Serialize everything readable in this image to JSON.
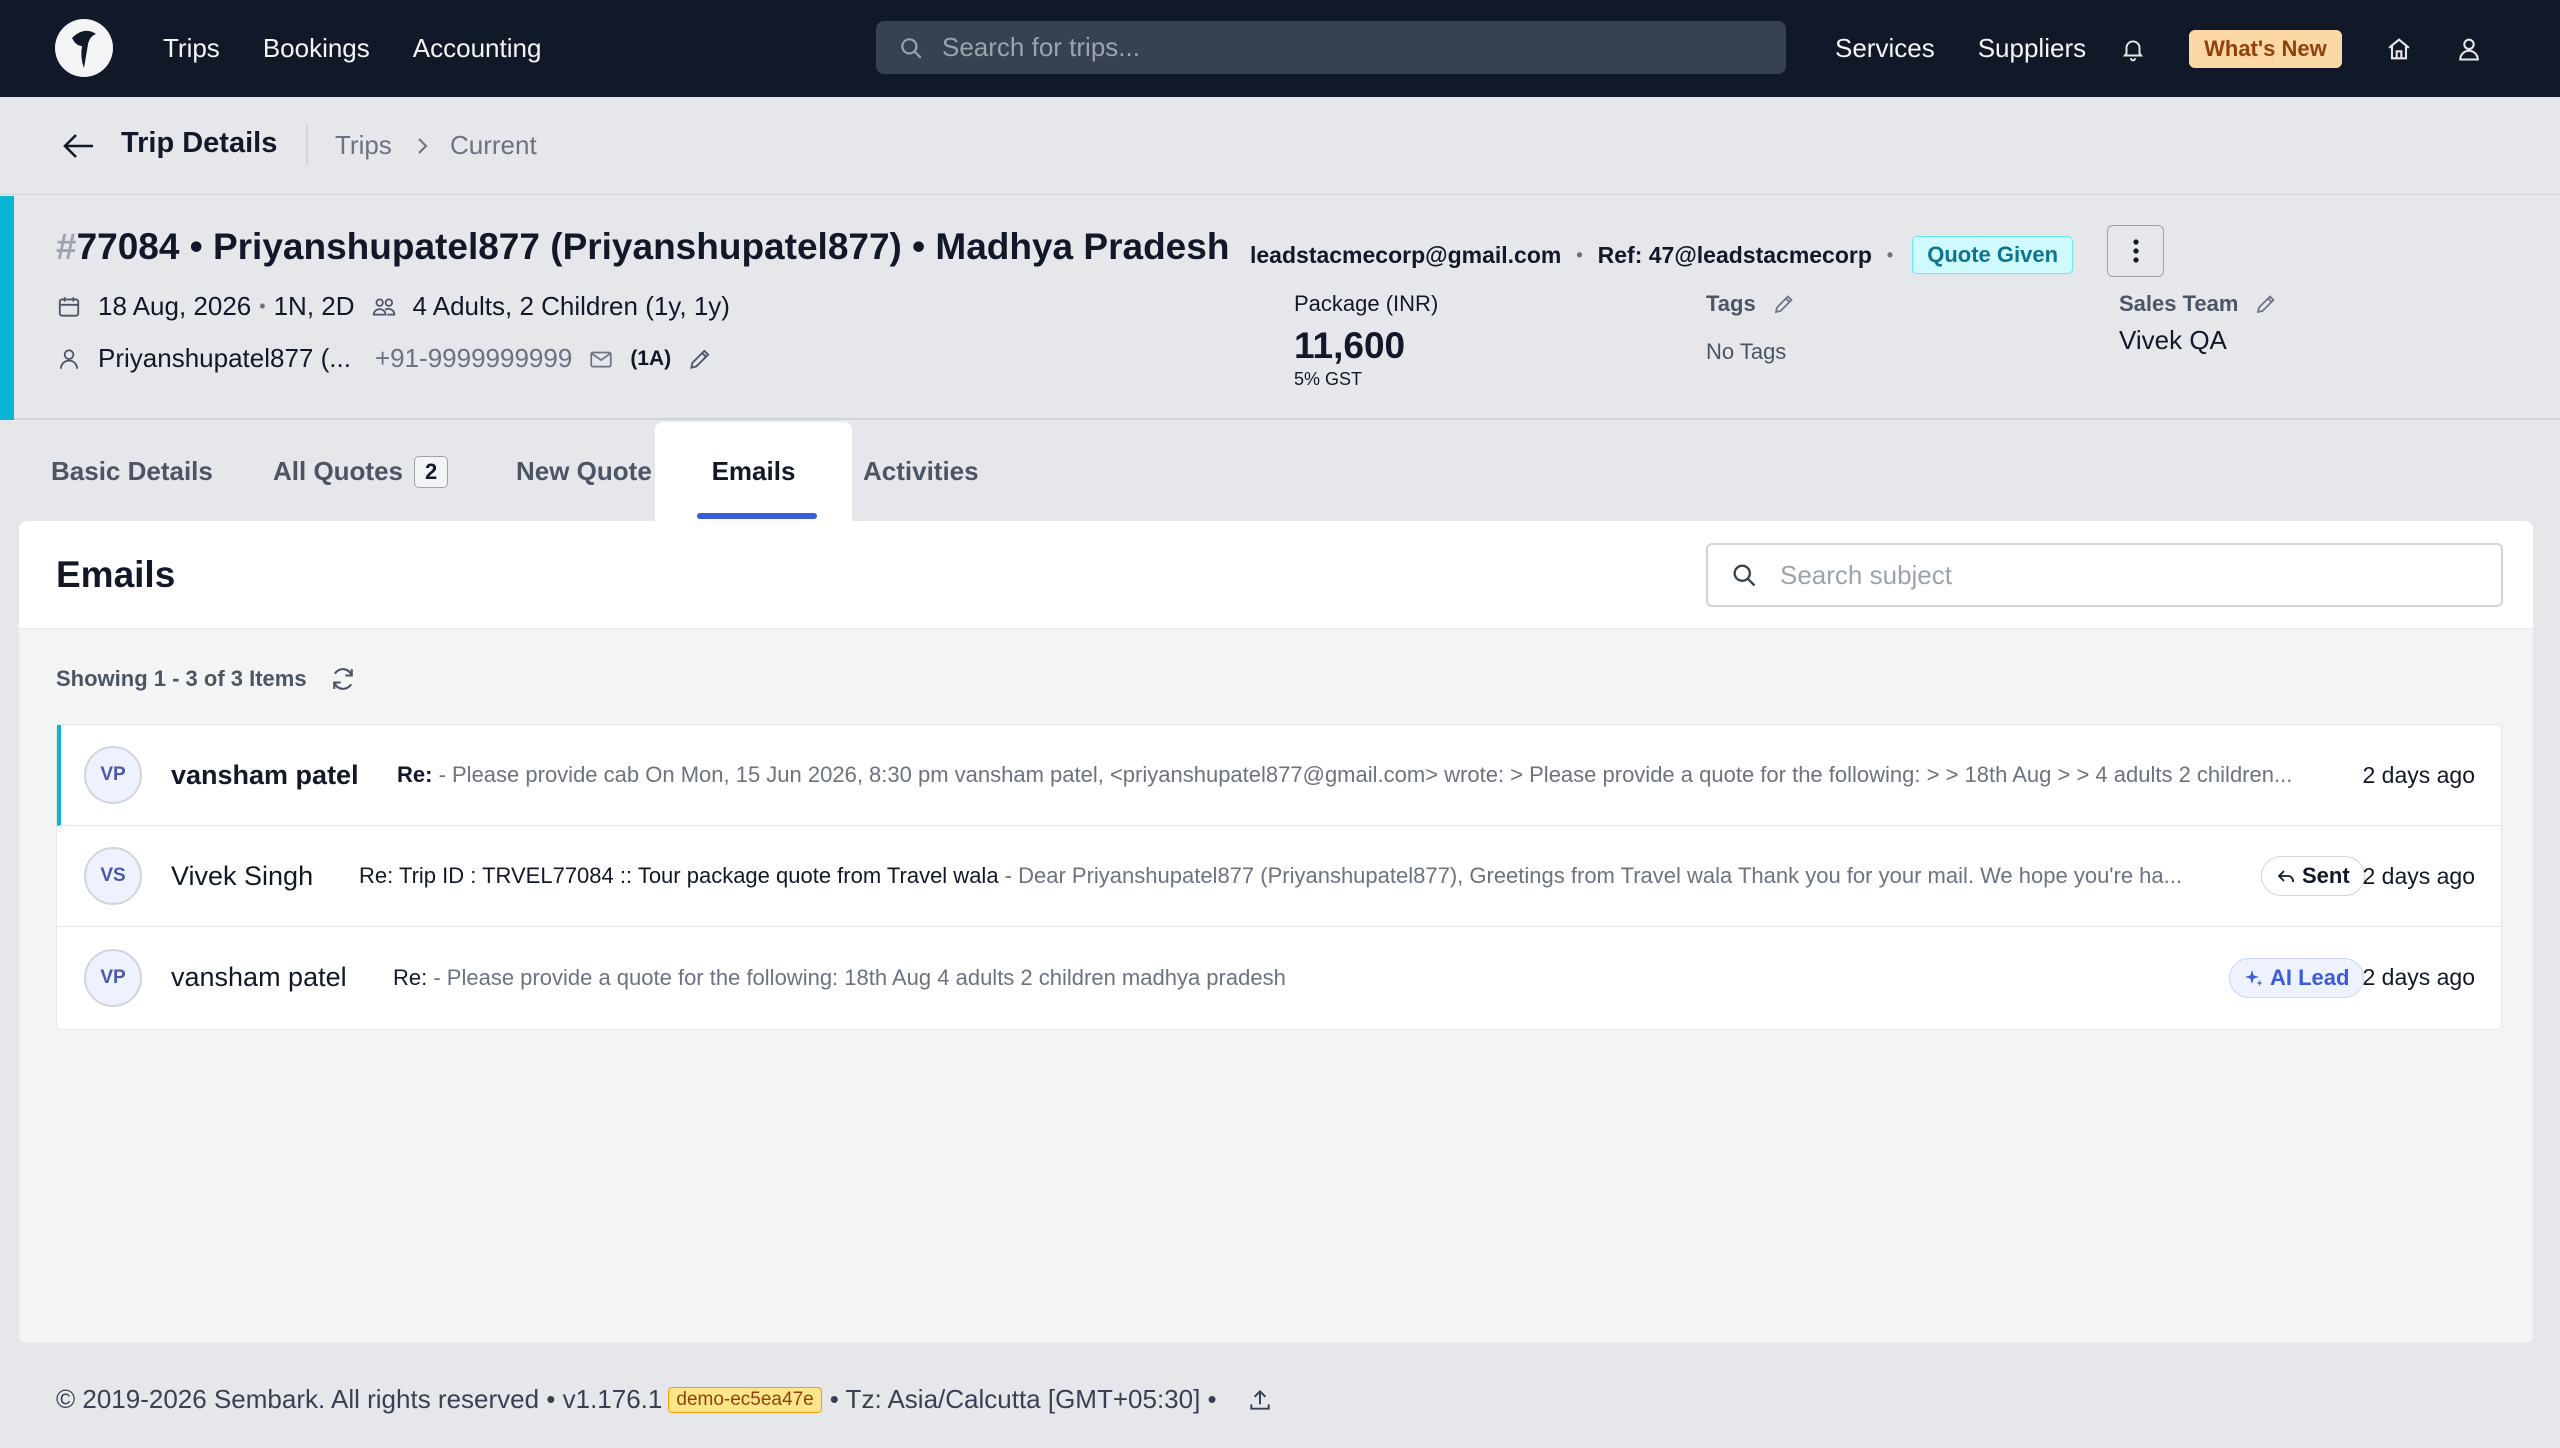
{
  "nav": {
    "links": [
      "Trips",
      "Bookings",
      "Accounting"
    ],
    "search_placeholder": "Search for trips...",
    "right_links": [
      "Services",
      "Suppliers"
    ],
    "whats_new": "What's New"
  },
  "breadcrumb": {
    "title": "Trip Details",
    "items": [
      "Trips",
      "Current"
    ]
  },
  "trip": {
    "title_hash": "#",
    "title": "77084 • Priyanshupatel877 (Priyanshupatel877) • Madhya Pradesh",
    "email": "leadstacmecorp@gmail.com",
    "ref": "Ref: 47@leadstacmecorp",
    "status": "Quote Given",
    "status_color": "#0e7490",
    "date": "18 Aug, 2026",
    "duration": "1N, 2D",
    "pax": "4 Adults, 2 Children (1y, 1y)",
    "contact_name": "Priyanshupatel877 (...",
    "phone": "+91-9999999999",
    "email_count": "(1A)",
    "package_label": "Package (INR)",
    "package_value": "11,600",
    "package_gst": "5% GST",
    "tags_label": "Tags",
    "tags_value": "No Tags",
    "sales_label": "Sales Team",
    "sales_value": "Vivek QA"
  },
  "tabs": [
    {
      "label": "Basic Details"
    },
    {
      "label": "All Quotes",
      "count": "2"
    },
    {
      "label": "New Quote"
    },
    {
      "label": "Emails"
    },
    {
      "label": "Activities"
    }
  ],
  "active_tab": "Emails",
  "emails_panel": {
    "title": "Emails",
    "search_placeholder": "Search subject",
    "showing": "Showing 1 - 3 of 3 Items",
    "rows": [
      {
        "initials": "VP",
        "sender": "vansham patel",
        "subject": "Re:",
        "preview": " - Please provide cab On Mon, 15 Jun 2026, 8:30 pm vansham patel, <priyanshupatel877@gmail.com> wrote: > Please provide a quote for the following: > > 18th Aug > > 4 adults 2 children...",
        "tag": "",
        "time": "2 days ago",
        "unread": true
      },
      {
        "initials": "VS",
        "sender": "Vivek Singh",
        "subject": "Re: Trip ID : TRVEL77084 :: Tour package quote from Travel wala",
        "preview": " - Dear Priyanshupatel877 (Priyanshupatel877), Greetings from Travel wala Thank you for your mail. We hope you're ha...",
        "tag": "Sent",
        "time": "2 days ago",
        "unread": false
      },
      {
        "initials": "VP",
        "sender": "vansham patel",
        "subject": "Re:",
        "preview": " - Please provide a quote for the following: 18th Aug 4 adults 2 children madhya pradesh",
        "tag": "AI Lead",
        "time": "2 days ago",
        "unread": false
      }
    ]
  },
  "footer": {
    "copyright": "© 2019-2026 Sembark. All rights reserved • v1.176.1",
    "env": "demo-ec5ea47e",
    "tz": "• Tz: Asia/Calcutta [GMT+05:30] •"
  },
  "icons": {
    "logo": "sembark-logo",
    "search": "search-icon",
    "bell": "bell-icon",
    "home": "home-icon",
    "user": "user-icon",
    "calendar": "calendar-icon",
    "people": "people-icon",
    "mail": "mail-icon",
    "pencil": "pencil-icon",
    "refresh": "refresh-icon",
    "reply": "reply-icon",
    "sparkle": "sparkle-icon",
    "upload": "upload-icon"
  },
  "colors": {
    "nav_bg": "#111827",
    "accent": "#06b6d4",
    "tab_underline": "#3b5bdb",
    "whats_new_bg": "#fcd9a4"
  }
}
